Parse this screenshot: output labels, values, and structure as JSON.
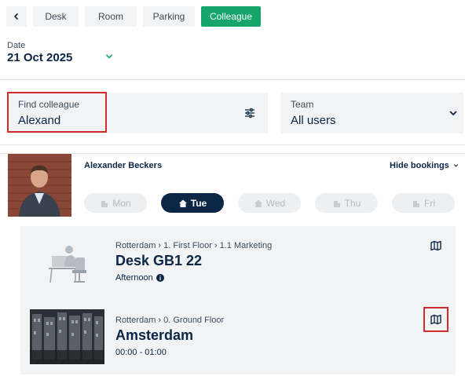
{
  "tabs": {
    "back_icon": "chevron-left-icon",
    "desk": "Desk",
    "room": "Room",
    "parking": "Parking",
    "colleague": "Colleague"
  },
  "date": {
    "label": "Date",
    "value": "21 Oct 2025"
  },
  "find": {
    "label": "Find colleague",
    "value": "Alexand"
  },
  "team": {
    "label": "Team",
    "value": "All users"
  },
  "person": {
    "name": "Alexander Beckers",
    "hide_bookings": "Hide bookings"
  },
  "days": [
    {
      "label": "Mon",
      "icon": "building-icon",
      "active": false
    },
    {
      "label": "Tue",
      "icon": "home-icon",
      "active": true
    },
    {
      "label": "Wed",
      "icon": "home-icon",
      "active": false
    },
    {
      "label": "Thu",
      "icon": "building-icon",
      "active": false
    },
    {
      "label": "Fri",
      "icon": "building-icon",
      "active": false
    }
  ],
  "bookings": [
    {
      "breadcrumb": "Rotterdam  ›  1. First Floor  ›  1.1 Marketing",
      "title": "Desk GB1 22",
      "subtitle": "Afternoon"
    },
    {
      "breadcrumb": "Rotterdam  ›  0. Ground Floor",
      "title": "Amsterdam",
      "subtitle": "00:00 - 01:00"
    }
  ],
  "colors": {
    "accent": "#16a56b",
    "navy": "#0b2545",
    "highlight": "#d62b2b"
  }
}
